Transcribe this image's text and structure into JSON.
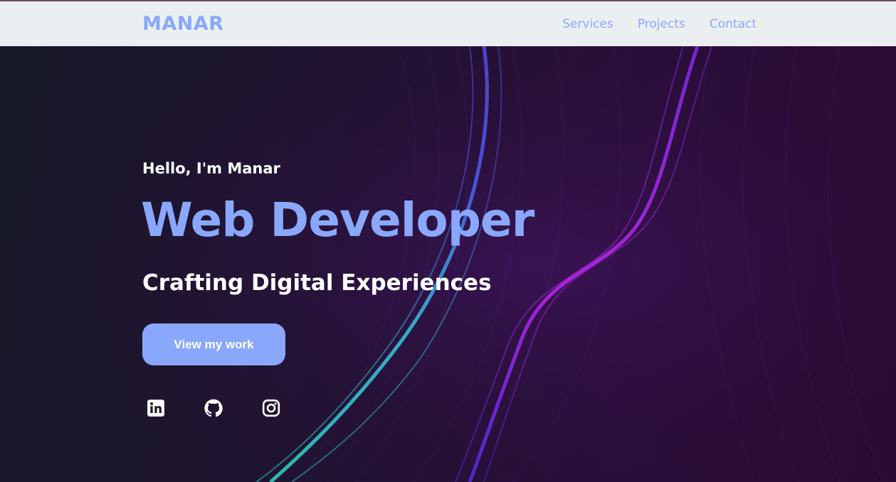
{
  "header": {
    "logo": "MANAR",
    "nav": [
      {
        "label": "Services"
      },
      {
        "label": "Projects"
      },
      {
        "label": "Contact"
      }
    ]
  },
  "hero": {
    "greeting": "Hello, I'm Manar",
    "title": "Web Developer",
    "subtitle": "Crafting Digital Experiences",
    "cta_label": "View my work",
    "social": [
      {
        "icon": "linkedin-icon"
      },
      {
        "icon": "github-icon"
      },
      {
        "icon": "instagram-icon"
      }
    ]
  },
  "colors": {
    "accent": "#8aa8fb",
    "nav_bg": "#eceff1",
    "hero_bg": "#1f1430",
    "text_light": "#ffffff"
  }
}
